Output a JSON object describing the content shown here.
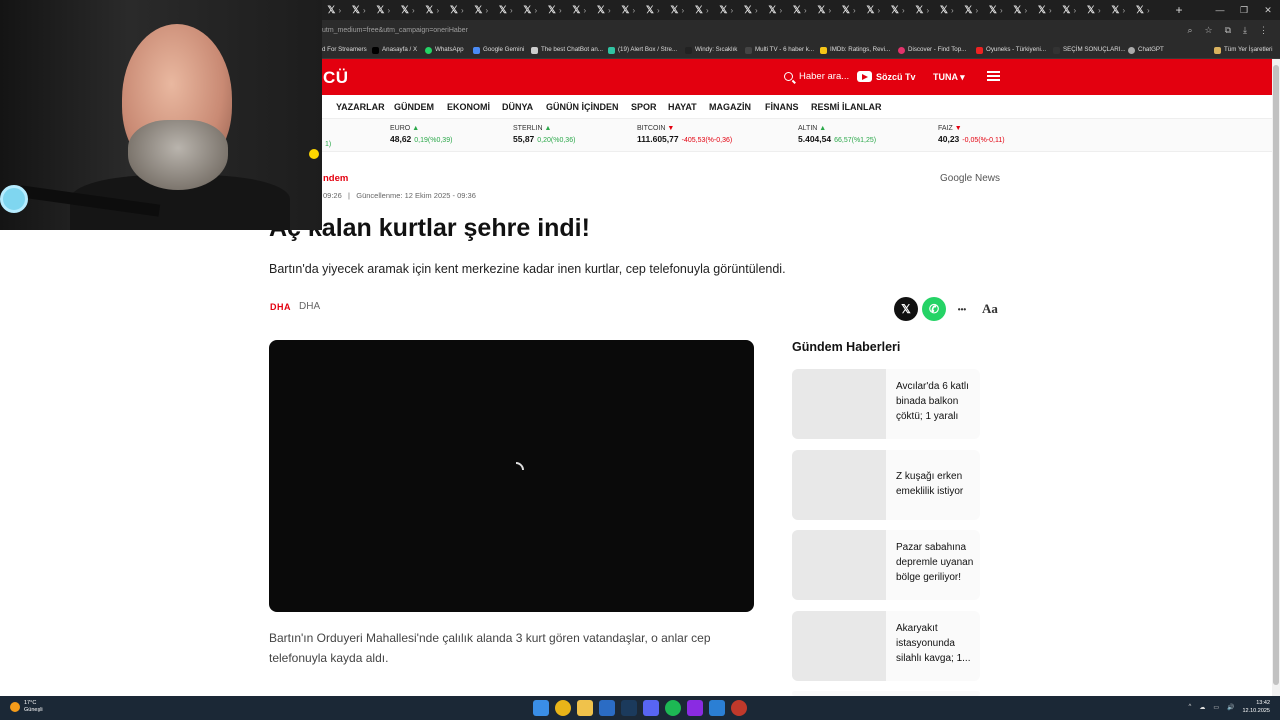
{
  "browser": {
    "url": "utm_medium=free&utm_campaign=oneriHaber",
    "tab_glyph": "𝕏",
    "tab_close": "›",
    "new_tab": "+",
    "window_controls": [
      "—",
      "❐",
      "✕"
    ],
    "bookmarks": [
      "d For Streamers",
      "Anasayfa / X",
      "WhatsApp",
      "Google Gemini",
      "The best ChatBot an...",
      "(19) Alert Box / Stre...",
      "Windy: Sıcaklık",
      "Multi TV - 6 haber k...",
      "IMDb: Ratings, Revi...",
      "Discover - Find Top...",
      "Oyuneks - Türkiyeni...",
      "SEÇİM SONUÇLARI...",
      "ChatGPT",
      "Tüm Yer İşaretleri"
    ]
  },
  "site": {
    "logo": "CÜ",
    "search_label": "Haber ara...",
    "tv_label": "Sözcü Tv",
    "user_label": "TUNA ▾",
    "nav": [
      "YAZARLAR",
      "GÜNDEM",
      "EKONOMİ",
      "DÜNYA",
      "GÜNÜN İÇİNDEN",
      "SPOR",
      "HAYAT",
      "MAGAZİN",
      "FİNANS",
      "RESMİ İLANLAR"
    ],
    "ticker_fragment": "1)",
    "ticker": [
      {
        "name": "EURO",
        "dir": "up",
        "value": "48,62",
        "change": "0,19(%0,39)"
      },
      {
        "name": "STERLIN",
        "dir": "up",
        "value": "55,87",
        "change": "0,20(%0,36)"
      },
      {
        "name": "BITCOIN",
        "dir": "down",
        "value": "111.605,77",
        "change": "-405,53(%-0,36)"
      },
      {
        "name": "ALTIN",
        "dir": "up",
        "value": "5.404,54",
        "change": "66,57(%1,25)"
      },
      {
        "name": "FAIZ",
        "dir": "down",
        "value": "40,23",
        "change": "-0,05(%-0,11)"
      }
    ]
  },
  "article": {
    "category": "ndem",
    "published": "09:26",
    "updated": "Güncellenme: 12 Ekim 2025 - 09:36",
    "google_news": "Google News",
    "title": "Aç kalan kurtlar şehre indi!",
    "spot": "Bartın'da yiyecek aramak için kent merkezine kadar inen kurtlar, cep telefonuyla görüntülendi.",
    "source_logo": "DHA",
    "source": "DHA",
    "share_x": "𝕏",
    "share_wa": "✆",
    "share_more": "•••",
    "font_size": "Aa",
    "body": "Bartın'ın Orduyeri Mahallesi'nde çalılık alanda 3 kurt gören vatandaşlar, o anlar cep telefonuyla kayda aldı."
  },
  "sidebar": {
    "heading": "Gündem Haberleri",
    "items": [
      "Avcılar'da 6 katlı binada balkon çöktü; 1 yaralı",
      "Z kuşağı erken emeklilik istiyor",
      "Pazar sabahına depremle uyanan bölge geriliyor!",
      "Akaryakıt istasyonunda silahlı kavga; 1..."
    ]
  },
  "taskbar": {
    "temp": "17°C",
    "weather": "Güneşli",
    "time": "13:42",
    "date": "12.10.2025",
    "tray_icons": [
      "^",
      "☁",
      "▭",
      "🔊"
    ]
  }
}
